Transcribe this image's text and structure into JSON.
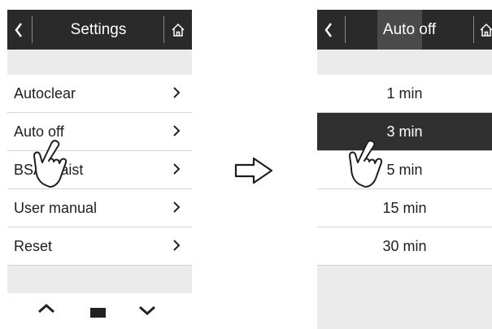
{
  "left_screen": {
    "header": {
      "back_icon": "chevron-left-icon",
      "title": "Settings",
      "home_icon": "home-icon"
    },
    "items": [
      {
        "label": "Autoclear"
      },
      {
        "label": "Auto off"
      },
      {
        "label": "BSA/Waist"
      },
      {
        "label": "User manual"
      },
      {
        "label": "Reset"
      }
    ],
    "pressed_item": "Auto off",
    "footer": {
      "up_icon": "chevron-up-icon",
      "down_icon": "chevron-down-icon"
    }
  },
  "transition_icon": "arrow-right-outline-icon",
  "right_screen": {
    "header": {
      "back_icon": "chevron-left-icon",
      "title": "Auto off",
      "home_icon": "home-icon"
    },
    "options": [
      {
        "label": "1 min"
      },
      {
        "label": "3 min"
      },
      {
        "label": "5 min"
      },
      {
        "label": "15 min"
      },
      {
        "label": "30 min"
      }
    ],
    "selected_option": "3 min"
  },
  "colors": {
    "header_bg": "#2a2a2a",
    "screen_bg": "#ebebeb",
    "row_bg": "#ffffff",
    "selected_bg": "#303030"
  }
}
